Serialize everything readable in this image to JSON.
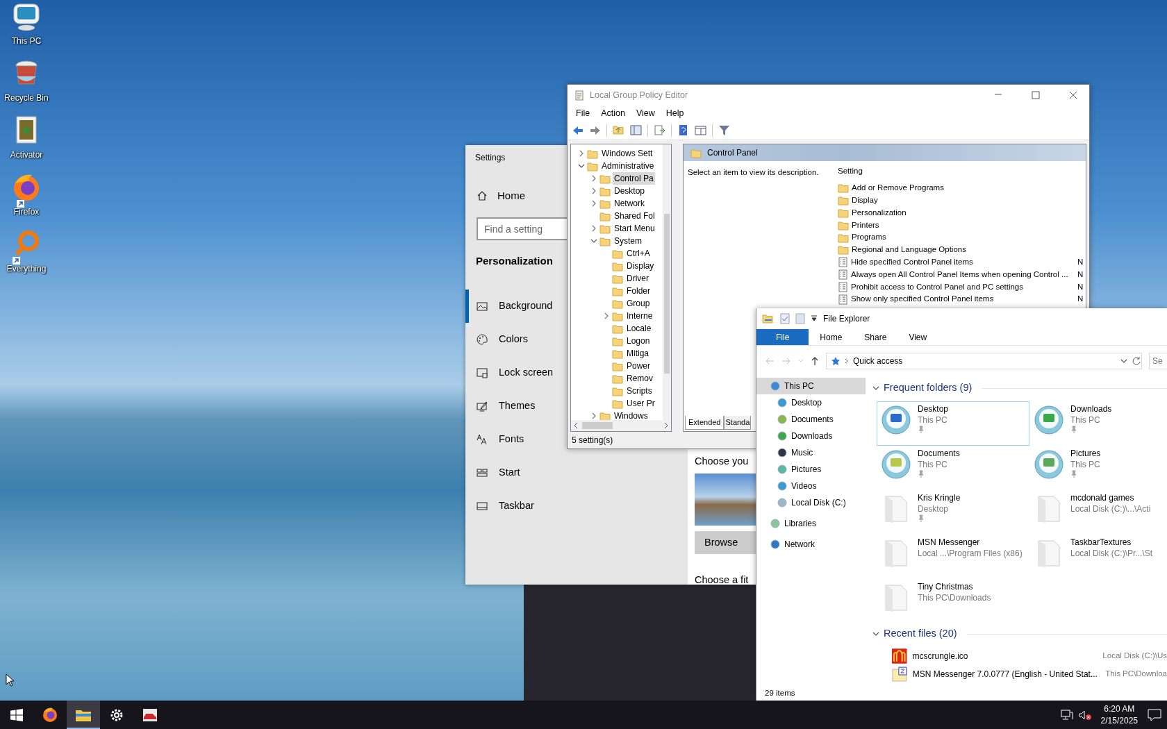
{
  "desktop": {
    "icons": [
      {
        "label": "This PC",
        "kind": "computer",
        "shortcut": false
      },
      {
        "label": "Recycle Bin",
        "kind": "recycle",
        "shortcut": false
      },
      {
        "label": "Activator",
        "kind": "file",
        "shortcut": false
      },
      {
        "label": "Firefox",
        "kind": "browser",
        "shortcut": true
      },
      {
        "label": "Everything",
        "kind": "search",
        "shortcut": true
      }
    ]
  },
  "settings": {
    "title": "Settings",
    "home": "Home",
    "search": {
      "placeholder": "Find a setting"
    },
    "section": "Personalization",
    "nav": [
      {
        "label": "Background",
        "kind": "background",
        "selected": true
      },
      {
        "label": "Colors",
        "kind": "colors",
        "selected": false
      },
      {
        "label": "Lock screen",
        "kind": "lock",
        "selected": false
      },
      {
        "label": "Themes",
        "kind": "themes",
        "selected": false
      },
      {
        "label": "Fonts",
        "kind": "fonts",
        "selected": false
      },
      {
        "label": "Start",
        "kind": "start",
        "selected": false
      },
      {
        "label": "Taskbar",
        "kind": "taskbar",
        "selected": false
      }
    ],
    "heading": "Choose you",
    "button": "Browse",
    "subheading": "Choose a fit"
  },
  "policy_editor": {
    "title": "Local Group Policy Editor",
    "menu": [
      "File",
      "Action",
      "View",
      "Help"
    ],
    "tree": [
      {
        "label": "Windows Sett",
        "expandable": true,
        "expanded": false,
        "selected": false
      },
      {
        "label": "Administrative",
        "expandable": true,
        "expanded": true,
        "selected": false,
        "children": [
          {
            "label": "Control Pa",
            "expandable": true,
            "expanded": false,
            "selected": true
          },
          {
            "label": "Desktop",
            "expandable": true,
            "expanded": false,
            "selected": false
          },
          {
            "label": "Network",
            "expandable": true,
            "expanded": false,
            "selected": false
          },
          {
            "label": "Shared Fol",
            "expandable": false,
            "expanded": false,
            "selected": false
          },
          {
            "label": "Start Menu",
            "expandable": true,
            "expanded": false,
            "selected": false
          },
          {
            "label": "System",
            "expandable": true,
            "expanded": true,
            "selected": false,
            "children": [
              {
                "label": "Ctrl+A",
                "expandable": false,
                "expanded": false,
                "selected": false
              },
              {
                "label": "Display",
                "expandable": false,
                "expanded": false,
                "selected": false
              },
              {
                "label": "Driver",
                "expandable": false,
                "expanded": false,
                "selected": false
              },
              {
                "label": "Folder",
                "expandable": false,
                "expanded": false,
                "selected": false
              },
              {
                "label": "Group",
                "expandable": false,
                "expanded": false,
                "selected": false
              },
              {
                "label": "Interne",
                "expandable": true,
                "expanded": false,
                "selected": false
              },
              {
                "label": "Locale",
                "expandable": false,
                "expanded": false,
                "selected": false
              },
              {
                "label": "Logon",
                "expandable": false,
                "expanded": false,
                "selected": false
              },
              {
                "label": "Mitiga",
                "expandable": false,
                "expanded": false,
                "selected": false
              },
              {
                "label": "Power",
                "expandable": false,
                "expanded": false,
                "selected": false
              },
              {
                "label": "Remov",
                "expandable": false,
                "expanded": false,
                "selected": false
              },
              {
                "label": "Scripts",
                "expandable": false,
                "expanded": false,
                "selected": false
              },
              {
                "label": "User Pr",
                "expandable": false,
                "expanded": false,
                "selected": false
              }
            ]
          },
          {
            "label": "Windows",
            "expandable": true,
            "expanded": false,
            "selected": false
          }
        ]
      }
    ],
    "pane_title": "Control Panel",
    "description": "Select an item to view its description.",
    "column": "Setting",
    "rows": [
      {
        "label": "Add or Remove Programs",
        "kind": "folder"
      },
      {
        "label": "Display",
        "kind": "folder"
      },
      {
        "label": "Personalization",
        "kind": "folder"
      },
      {
        "label": "Printers",
        "kind": "folder"
      },
      {
        "label": "Programs",
        "kind": "folder"
      },
      {
        "label": "Regional and Language Options",
        "kind": "folder"
      },
      {
        "label": "Hide specified Control Panel items",
        "kind": "policy",
        "column_2": "N"
      },
      {
        "label": "Always open All Control Panel Items when opening Control ...",
        "kind": "policy",
        "column_2": "N"
      },
      {
        "label": "Prohibit access to Control Panel and PC settings",
        "kind": "policy",
        "column_2": "N"
      },
      {
        "label": "Show only specified Control Panel items",
        "kind": "policy",
        "column_2": "N"
      }
    ],
    "tabs": [
      {
        "label": "Extended",
        "selected": true
      },
      {
        "label": "Standa",
        "selected": false
      }
    ],
    "status": "5 setting(s)"
  },
  "file_explorer": {
    "title": "File Explorer",
    "ribbon_tabs": [
      {
        "label": "File",
        "selected": true
      },
      {
        "label": "Home",
        "selected": false
      },
      {
        "label": "Share",
        "selected": false
      },
      {
        "label": "View",
        "selected": false
      }
    ],
    "address": "Quick access",
    "search": {
      "placeholder": "Se"
    },
    "nav": [
      {
        "label": "This PC",
        "kind": "pc",
        "selected": true,
        "children": [
          {
            "label": "Desktop",
            "kind": "desktop",
            "selected": false
          },
          {
            "label": "Documents",
            "kind": "documents",
            "selected": false
          },
          {
            "label": "Downloads",
            "kind": "downloads",
            "selected": false
          },
          {
            "label": "Music",
            "kind": "music",
            "selected": false
          },
          {
            "label": "Pictures",
            "kind": "pictures",
            "selected": false
          },
          {
            "label": "Videos",
            "kind": "videos",
            "selected": false
          },
          {
            "label": "Local Disk (C:)",
            "kind": "disk",
            "selected": false
          }
        ]
      },
      {
        "label": "Libraries",
        "kind": "libraries",
        "selected": false
      },
      {
        "label": "Network",
        "kind": "network",
        "selected": false
      }
    ],
    "frequent": {
      "heading": "Frequent folders (9)",
      "items": [
        {
          "name": "Desktop",
          "location": "This PC",
          "kind": "desktop",
          "pinned": true,
          "selected": true
        },
        {
          "name": "Downloads",
          "location": "This PC",
          "kind": "downloads",
          "pinned": true,
          "selected": false
        },
        {
          "name": "Documents",
          "location": "This PC",
          "kind": "documents",
          "pinned": true,
          "selected": false
        },
        {
          "name": "Pictures",
          "location": "This PC",
          "kind": "pictures",
          "pinned": true,
          "selected": false
        },
        {
          "name": "Kris Kringle",
          "location": "Desktop",
          "kind": "folder",
          "pinned": true,
          "selected": false
        },
        {
          "name": "mcdonald games",
          "location": "Local Disk (C:)\\...\\Acti",
          "kind": "folder",
          "pinned": false,
          "selected": false
        },
        {
          "name": "MSN Messenger",
          "location": "Local ...\\Program Files (x86)",
          "kind": "folder",
          "pinned": false,
          "selected": false
        },
        {
          "name": "TaskbarTextures",
          "location": "Local Disk (C:)\\Pr...\\St",
          "kind": "folder",
          "pinned": false,
          "selected": false
        },
        {
          "name": "Tiny Christmas",
          "location": "This PC\\Downloads",
          "kind": "folder",
          "pinned": false,
          "selected": false
        }
      ]
    },
    "recent": {
      "heading": "Recent files (20)",
      "items": [
        {
          "name": "mcscrungle.ico",
          "location": "Local Disk (C:)\\Us",
          "kind": "image"
        },
        {
          "name": "MSN Messenger 7.0.0777 (English - United Stat...",
          "location": "This PC\\Downloa",
          "kind": "installer"
        }
      ]
    },
    "status": "29 items"
  },
  "taskbar": {
    "apps": [
      {
        "kind": "browser",
        "active": false
      },
      {
        "kind": "explorer",
        "active": true
      },
      {
        "kind": "settings",
        "active": false
      },
      {
        "kind": "app",
        "active": false
      }
    ],
    "time": "6:20 AM",
    "date": "2/15/2025",
    "volume_muted": true
  }
}
